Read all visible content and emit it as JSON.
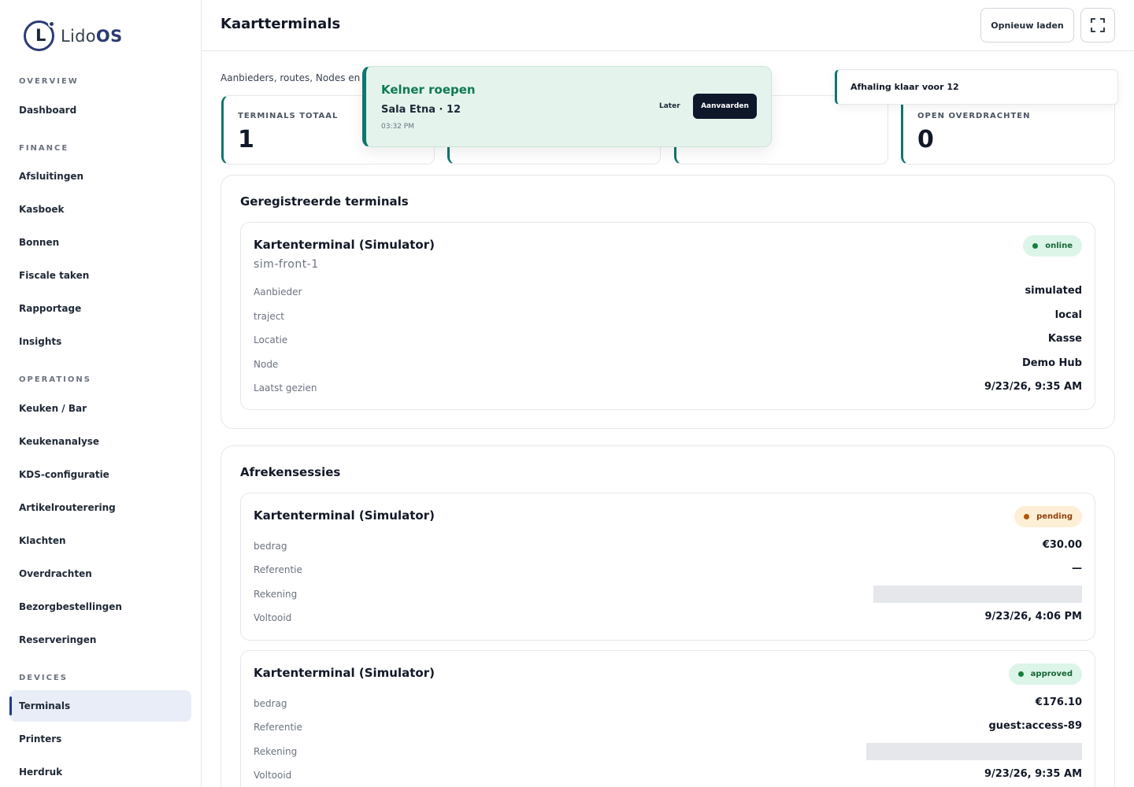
{
  "brand": {
    "name_part1": "Lido",
    "name_part2": "OS"
  },
  "sidebar": {
    "sections": [
      {
        "title": "OVERVIEW",
        "items": [
          "Dashboard"
        ]
      },
      {
        "title": "FINANCE",
        "items": [
          "Afsluitingen",
          "Kasboek",
          "Bonnen",
          "Fiscale taken",
          "Rapportage",
          "Insights"
        ]
      },
      {
        "title": "OPERATIONS",
        "items": [
          "Keuken / Bar",
          "Keukenanalyse",
          "KDS-configuratie",
          "Artikelrouterering",
          "Klachten",
          "Overdrachten",
          "Bezorgbestellingen",
          "Reserveringen"
        ]
      },
      {
        "title": "DEVICES",
        "items": [
          "Terminals",
          "Printers",
          "Herdruk"
        ]
      }
    ],
    "active_item": "Terminals"
  },
  "header": {
    "title": "Kaartterminals",
    "reload_label": "Opnieuw laden",
    "fullscreen_icon": "fullscreen-icon"
  },
  "subtitle": "Aanbieders, routes, Nodes en laa",
  "stats": [
    {
      "label": "TERMINALS TOTAAL",
      "value": "1"
    },
    {
      "label": "",
      "value": ""
    },
    {
      "label": "",
      "value": ""
    },
    {
      "label": "OPEN OVERDRACHTEN",
      "value": "0"
    }
  ],
  "terminals_panel": {
    "title": "Geregistreerde terminals",
    "terminal": {
      "name": "Kartenterminal (Simulator)",
      "id": "sim-front-1",
      "status": "online",
      "rows": [
        {
          "label": "Aanbieder",
          "value": "simulated"
        },
        {
          "label": "traject",
          "value": "local"
        },
        {
          "label": "Locatie",
          "value": "Kasse"
        },
        {
          "label": "Node",
          "value": "Demo Hub"
        },
        {
          "label": "Laatst gezien",
          "value": "9/23/26, 9:35 AM"
        }
      ]
    }
  },
  "sessions_panel": {
    "title": "Afrekensessies",
    "sessions": [
      {
        "name": "Kartenterminal (Simulator)",
        "status": "pending",
        "bedrag_label": "bedrag",
        "bedrag": "€30.00",
        "referentie_label": "Referentie",
        "referentie": "—",
        "rekening_label": "Rekening",
        "voltooid_label": "Voltooid",
        "voltooid": "9/23/26, 4:06 PM"
      },
      {
        "name": "Kartenterminal (Simulator)",
        "status": "approved",
        "bedrag_label": "bedrag",
        "bedrag": "€176.10",
        "referentie_label": "Referentie",
        "referentie": "guest:access-89",
        "rekening_label": "Rekening",
        "voltooid_label": "Voltooid",
        "voltooid": "9/23/26, 9:35 AM"
      }
    ]
  },
  "toast": {
    "title": "Kelner roepen",
    "subtitle": "Sala Etna · 12",
    "time": "03:32 PM",
    "later_label": "Later",
    "accept_label": "Aanvaarden"
  },
  "side_toast": {
    "text": "Afhaling klaar voor 12"
  },
  "colors": {
    "accent": "#0f766e",
    "brand": "#2b3b75",
    "dark_button": "#0f172a"
  }
}
